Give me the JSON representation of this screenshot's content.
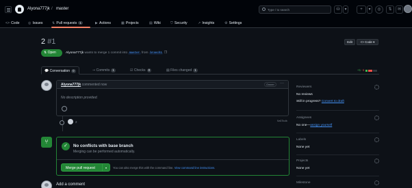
{
  "header": {
    "owner": "Alyona777jk",
    "separator": "/",
    "repo": "master",
    "search_placeholder": "Type / to search",
    "plus_label": "+",
    "caret": "▾"
  },
  "repo_nav": {
    "tabs": [
      {
        "label": "Code",
        "icon": "<>"
      },
      {
        "label": "Issues",
        "icon": "◎"
      },
      {
        "label": "Pull requests",
        "icon": "⇅",
        "count": "1"
      },
      {
        "label": "Actions",
        "icon": "▶"
      },
      {
        "label": "Projects",
        "icon": "▦"
      },
      {
        "label": "Wiki",
        "icon": "▤"
      },
      {
        "label": "Security",
        "icon": "⛉"
      },
      {
        "label": "Insights",
        "icon": "↗"
      },
      {
        "label": "Settings",
        "icon": "⚙"
      }
    ]
  },
  "pr": {
    "title": "2",
    "number": "#1",
    "state": "Open",
    "author": "Alyona777jk",
    "merge_text_1": "wants to merge 1 commit into",
    "base_branch": "master",
    "merge_text_2": "from",
    "head_branch": "branch1",
    "edit_label": "Edit",
    "code_label": "<> Code ▾"
  },
  "pr_tabs": [
    {
      "label": "Conversation",
      "count": "0"
    },
    {
      "label": "Commits",
      "count": "1"
    },
    {
      "label": "Checks",
      "count": "0"
    },
    {
      "label": "Files changed",
      "count": "1"
    }
  ],
  "diffstat": {
    "additions": "+1",
    "deletions": "-1"
  },
  "comment": {
    "author": "Alyona777jk",
    "meta": "commented now",
    "owner_badge": "Owner",
    "menu": "···",
    "body": "No description provided."
  },
  "timeline_commit": {
    "label": "2",
    "sha": "5e97bdb"
  },
  "merge": {
    "heading": "No conflicts with base branch",
    "subtext": "Merging can be performed automatically.",
    "button_label": "Merge pull request",
    "caret": "▾",
    "hint": "You can also merge this with the command line.",
    "hint_link": "View command line instructions."
  },
  "add_comment": "Add a comment",
  "sidebar": {
    "reviewers": {
      "heading": "Reviewers",
      "value": "No reviews",
      "progress": "Still in progress?",
      "link": "Convert to draft"
    },
    "assignees": {
      "heading": "Assignees",
      "value": "No one—",
      "link": "assign yourself"
    },
    "labels": {
      "heading": "Labels",
      "value": "None yet"
    },
    "projects": {
      "heading": "Projects",
      "value": "None yet"
    },
    "milestone": {
      "heading": "Milestone"
    }
  },
  "colors": {
    "background": "#0d1117",
    "header": "#010409",
    "accent_green": "#238636",
    "link_blue": "#4493f8",
    "tab_underline": "#f78166"
  }
}
